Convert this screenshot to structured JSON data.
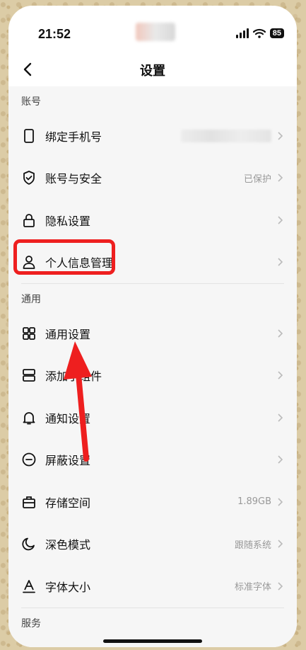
{
  "status_bar": {
    "time": "21:52",
    "battery": "85"
  },
  "nav": {
    "title": "设置"
  },
  "sections": [
    {
      "label": "账号",
      "items": [
        {
          "label": "绑定手机号",
          "value": "",
          "icon": "phone-icon"
        },
        {
          "label": "账号与安全",
          "value": "已保护",
          "icon": "shield-check-icon"
        },
        {
          "label": "隐私设置",
          "value": "",
          "icon": "lock-icon"
        },
        {
          "label": "个人信息管理",
          "value": "",
          "icon": "person-icon"
        }
      ]
    },
    {
      "label": "通用",
      "items": [
        {
          "label": "通用设置",
          "value": "",
          "icon": "grid-icon"
        },
        {
          "label": "添加小组件",
          "value": "",
          "icon": "widget-icon"
        },
        {
          "label": "通知设置",
          "value": "",
          "icon": "bell-icon"
        },
        {
          "label": "屏蔽设置",
          "value": "",
          "icon": "minus-circle-icon"
        },
        {
          "label": "存储空间",
          "value": "1.89GB",
          "icon": "storage-icon"
        },
        {
          "label": "深色模式",
          "value": "跟随系统",
          "icon": "moon-icon"
        },
        {
          "label": "字体大小",
          "value": "标准字体",
          "icon": "font-size-icon"
        }
      ]
    },
    {
      "label": "服务",
      "items": []
    }
  ],
  "colors": {
    "highlight": "#ee1f1f",
    "text": "#111111",
    "secondary": "#999999"
  }
}
